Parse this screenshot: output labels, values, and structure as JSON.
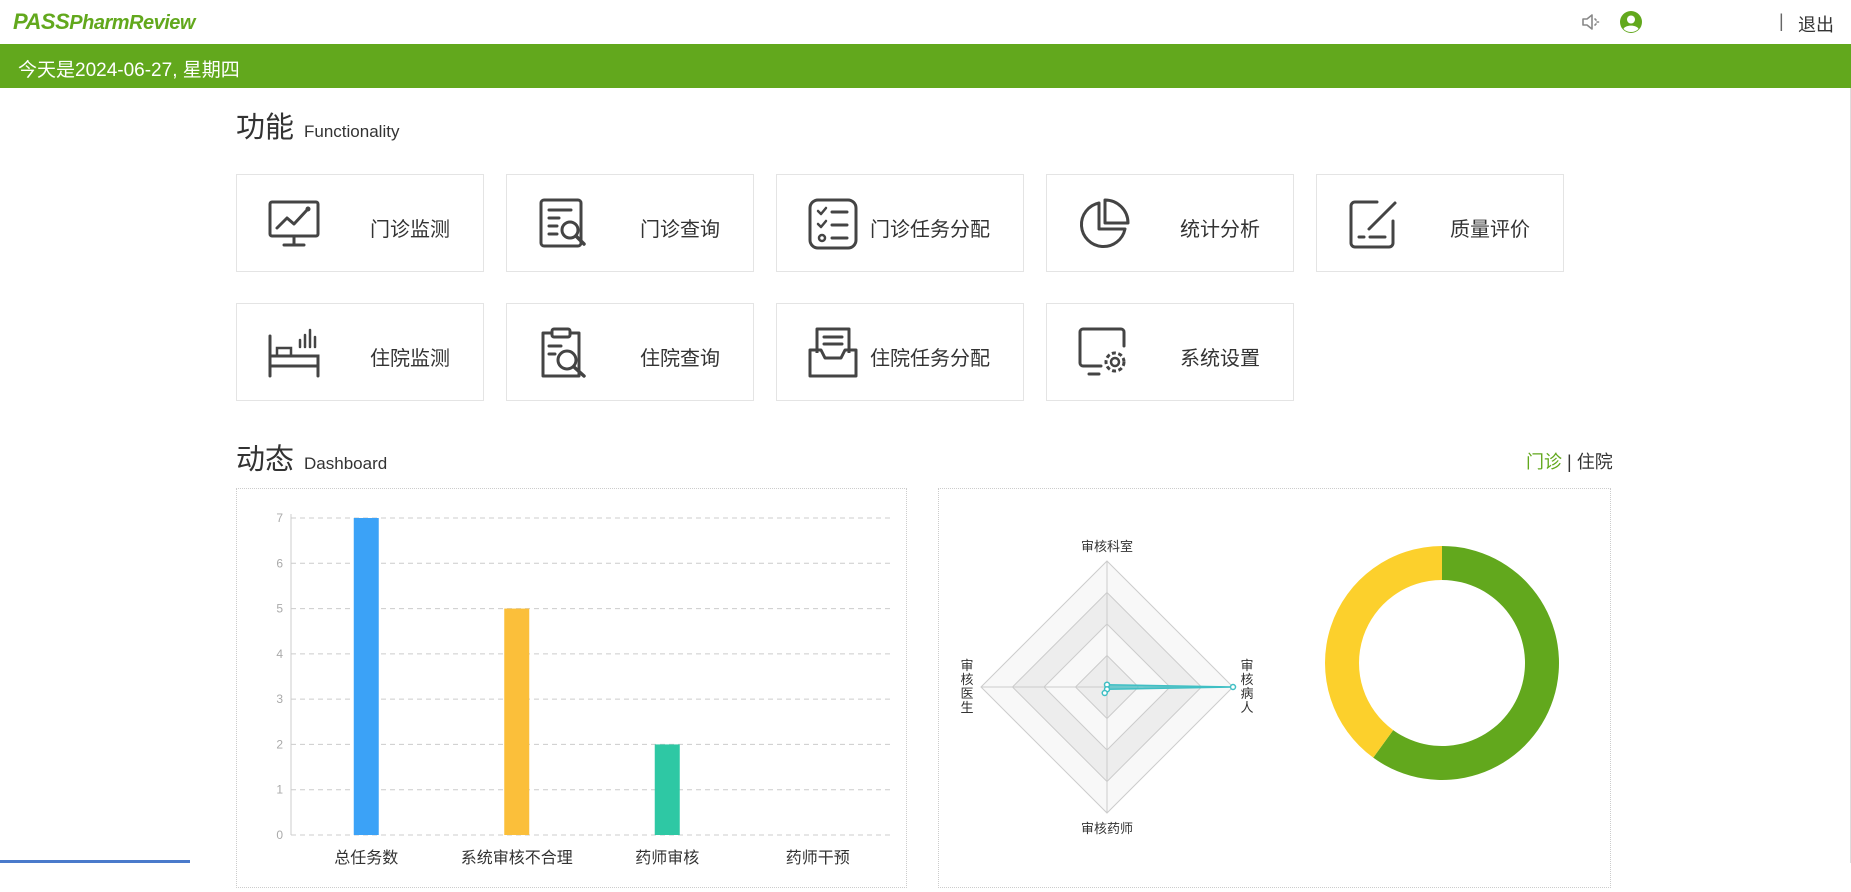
{
  "header": {
    "logo_main": "PASS",
    "logo_sub": "PharmReview",
    "separator": "|",
    "logout_label": "退出",
    "icons": [
      "speaker-mute-icon",
      "user-icon"
    ]
  },
  "datebar": {
    "text": "今天是2024-06-27, 星期四"
  },
  "functionality": {
    "title_cn": "功能",
    "title_en": "Functionality",
    "items": [
      {
        "label": "门诊监测",
        "icon": "monitor-chart-icon"
      },
      {
        "label": "门诊查询",
        "icon": "document-search-icon"
      },
      {
        "label": "门诊任务分配",
        "icon": "checklist-icon"
      },
      {
        "label": "统计分析",
        "icon": "pie-chart-icon"
      },
      {
        "label": "质量评价",
        "icon": "edit-square-icon"
      },
      {
        "label": "住院监测",
        "icon": "bed-chart-icon"
      },
      {
        "label": "住院查询",
        "icon": "clipboard-search-icon"
      },
      {
        "label": "住院任务分配",
        "icon": "inbox-tray-icon"
      },
      {
        "label": "系统设置",
        "icon": "screen-gear-icon"
      }
    ]
  },
  "dashboard": {
    "title_cn": "动态",
    "title_en": "Dashboard",
    "toggle": {
      "active": "门诊",
      "separator": "|",
      "inactive": "住院"
    }
  },
  "colors": {
    "brand": "#62a81d",
    "bar_blue": "#3ba2f7",
    "bar_orange": "#fbbf3a",
    "bar_teal": "#2ec8a4",
    "donut_green": "#62a81d",
    "donut_yellow": "#fcd02c",
    "radar_line": "#3fbfc4"
  },
  "chart_data": [
    {
      "type": "bar",
      "categories": [
        "总任务数",
        "系统审核不合理",
        "药师审核",
        "药师干预"
      ],
      "values": [
        7,
        5,
        2,
        0
      ],
      "ylim": [
        0,
        7
      ],
      "yticks": [
        0,
        1,
        2,
        3,
        4,
        5,
        6,
        7
      ],
      "grid": true
    },
    {
      "type": "radar",
      "indicators": [
        "审核科室",
        "审核病人",
        "审核药师",
        "审核医生"
      ],
      "values": [
        0,
        1,
        0,
        0.01
      ],
      "max": 1
    },
    {
      "type": "pie",
      "donut": true,
      "slices": [
        {
          "color": "#62a81d",
          "value": 0.6
        },
        {
          "color": "#fcd02c",
          "value": 0.4
        }
      ]
    }
  ]
}
